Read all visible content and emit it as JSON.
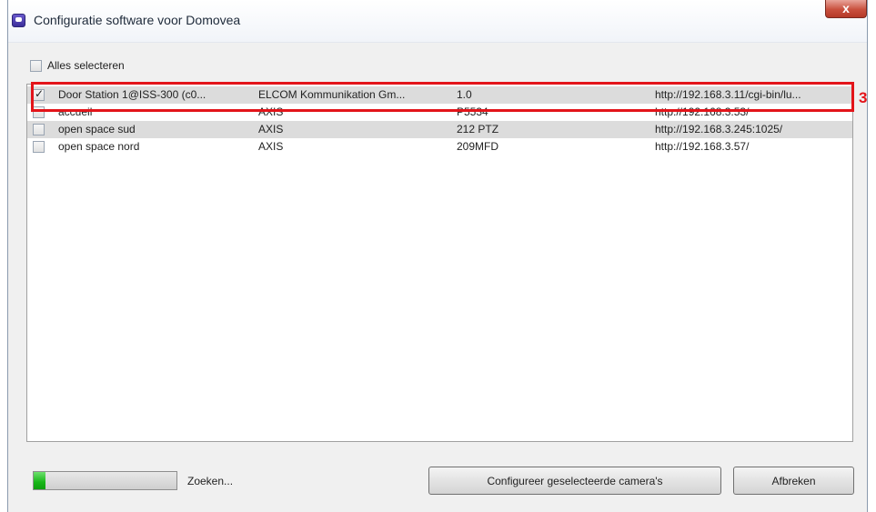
{
  "window": {
    "title": "Configuratie software voor Domovea",
    "close_label": "x"
  },
  "select_all": {
    "label": "Alles selecteren",
    "checked": false
  },
  "cameras": [
    {
      "checked": true,
      "name": "Door Station 1@ISS-300 (c0...",
      "vendor": "ELCOM Kommunikation Gm...",
      "model": "1.0",
      "url": "http://192.168.3.11/cgi-bin/lu..."
    },
    {
      "checked": false,
      "name": "accueil",
      "vendor": "AXIS",
      "model": "P5534",
      "url": "http://192.168.3.53/"
    },
    {
      "checked": false,
      "name": "open space sud",
      "vendor": "AXIS",
      "model": "212 PTZ",
      "url": "http://192.168.3.245:1025/"
    },
    {
      "checked": false,
      "name": "open space nord",
      "vendor": "AXIS",
      "model": "209MFD",
      "url": "http://192.168.3.57/"
    }
  ],
  "annotation": {
    "marker": "3",
    "color": "#e3141a"
  },
  "progress": {
    "fraction": 0.08,
    "color": "#17b517"
  },
  "status": {
    "text": "Zoeken..."
  },
  "buttons": {
    "configure_label": "Configureer geselecteerde camera's",
    "cancel_label": "Afbreken"
  }
}
